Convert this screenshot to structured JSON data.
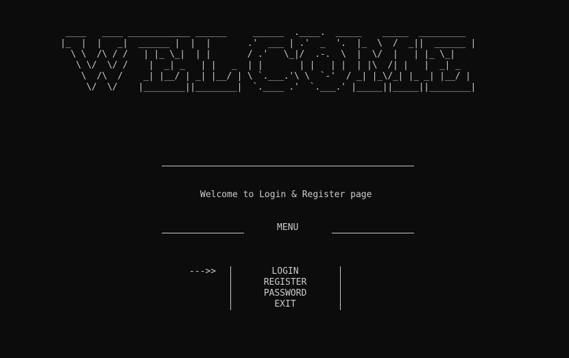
{
  "banner": {
    "art": " ____   ____ ____________ ______     ______  .____.  _____    _____  _________\n|_  |  |   _|  ______ |  |  |       .'  ___ | .'  _  '.  |_  \\  /  _||  ______ |\n  \\ \\  /\\ / /   | |_ \\_|  | |       / .'   \\_|/  .-.  \\  |  \\/  |   | |_ \\_|\n   \\ \\/  \\/ /    |  _| _   | |   _  | |       | |   | |  | |\\  /| |   |  _| _\n    \\  /\\  /    _| |__/ | _| |__/ | \\ `.___.'\\ \\  `-'  / _| |_\\/_| |_ _| |__/ |\n     \\/  \\/    |________||________|  `.____ .'  `.___.' |_____||_____||________|"
  },
  "divider_top": "",
  "subtitle": "Welcome to Login & Register page",
  "menu": {
    "title": "MENU",
    "cursor": "--->>",
    "items": [
      "LOGIN",
      "REGISTER",
      "PASSWORD",
      "EXIT"
    ],
    "selected_index": 0
  }
}
